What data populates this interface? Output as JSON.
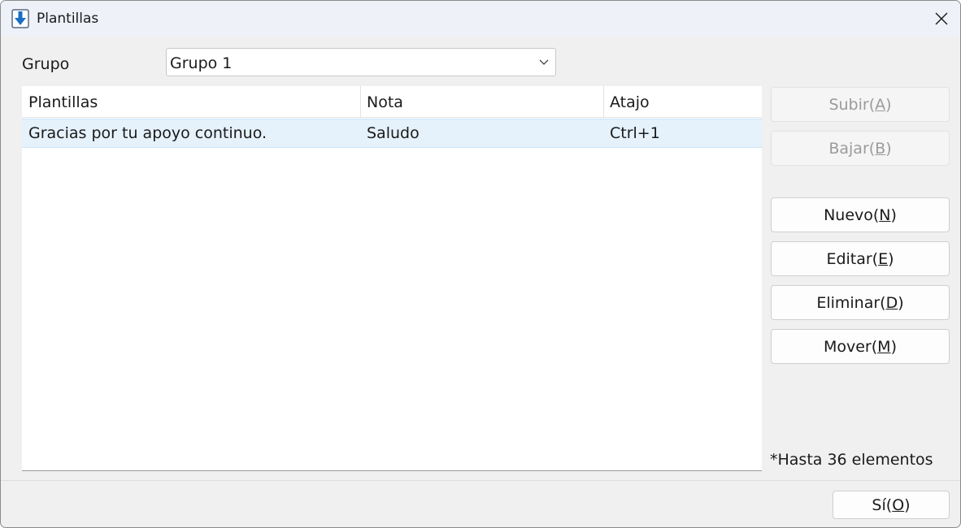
{
  "window": {
    "title": "Plantillas"
  },
  "group": {
    "label": "Grupo",
    "selected": "Grupo 1"
  },
  "table": {
    "columns": [
      "Plantillas",
      "Nota",
      "Atajo"
    ],
    "rows": [
      {
        "template": "Gracias por tu apoyo continuo.",
        "note": "Saludo",
        "shortcut": "Ctrl+1"
      }
    ]
  },
  "buttons": {
    "up": {
      "text": "Subir(",
      "key": "A",
      "end": ")"
    },
    "down": {
      "text": "Bajar(",
      "key": "B",
      "end": ")"
    },
    "new": {
      "text": "Nuevo(",
      "key": "N",
      "end": ")"
    },
    "edit": {
      "text": "Editar(",
      "key": "E",
      "end": ")"
    },
    "delete": {
      "text": "Eliminar(",
      "key": "D",
      "end": ")"
    },
    "move": {
      "text": "Mover(",
      "key": "M",
      "end": ")"
    },
    "ok": {
      "text": "Sí(",
      "key": "O",
      "end": ")"
    }
  },
  "limit_note": "*Hasta 36 elementos",
  "icons": {
    "app": "download-arrow-icon",
    "close": "close-icon",
    "dropdown": "chevron-down-icon"
  },
  "colors": {
    "accent": "#1a6fc4",
    "selection": "#e5f1fb"
  }
}
